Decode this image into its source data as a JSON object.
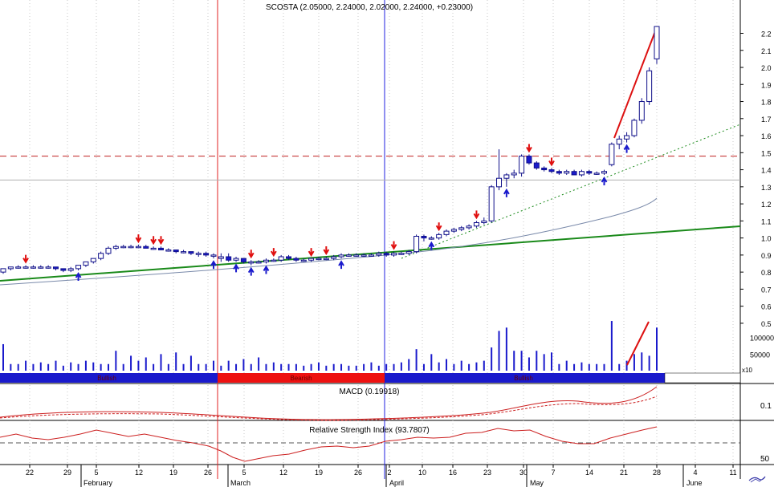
{
  "chart_data": {
    "type": "candlestick",
    "title": "SCOSTA (2.05000, 2.24000, 2.02000, 2.24000, +0.23000)",
    "y_ticks": [
      "2.2",
      "2.1",
      "2.0",
      "1.9",
      "1.8",
      "1.7",
      "1.6",
      "1.5",
      "1.4",
      "1.3",
      "1.2",
      "1.1",
      "1.0",
      "0.9",
      "0.8",
      "0.7",
      "0.6",
      "0.5"
    ],
    "ylim": [
      0.5,
      2.3
    ],
    "volume_ticks": [
      "100000",
      "50000"
    ],
    "volume_unit": "x10",
    "date_ticks": [
      "22",
      "29",
      "5",
      "12",
      "19",
      "26",
      "5",
      "12",
      "19",
      "26",
      "2",
      "10",
      "16",
      "23",
      "30",
      "7",
      "14",
      "21",
      "28",
      "4",
      "11"
    ],
    "months": [
      "February",
      "March",
      "April",
      "May",
      "June"
    ],
    "trend_bands": [
      {
        "label": "Bullish",
        "color": "#1a1acc"
      },
      {
        "label": "Bearish",
        "color": "#ee1111"
      },
      {
        "label": "Bullish",
        "color": "#1a1acc"
      }
    ],
    "resistance_level": 1.48,
    "support_level": 1.34,
    "candles": [
      [
        0.8,
        0.82,
        0.79,
        0.82
      ],
      [
        0.82,
        0.83,
        0.81,
        0.83
      ],
      [
        0.83,
        0.84,
        0.82,
        0.83
      ],
      [
        0.83,
        0.84,
        0.82,
        0.83
      ],
      [
        0.83,
        0.84,
        0.82,
        0.83
      ],
      [
        0.83,
        0.84,
        0.82,
        0.83
      ],
      [
        0.83,
        0.84,
        0.82,
        0.83
      ],
      [
        0.83,
        0.83,
        0.81,
        0.82
      ],
      [
        0.82,
        0.82,
        0.8,
        0.81
      ],
      [
        0.81,
        0.83,
        0.8,
        0.82
      ],
      [
        0.82,
        0.84,
        0.81,
        0.84
      ],
      [
        0.84,
        0.86,
        0.83,
        0.86
      ],
      [
        0.86,
        0.88,
        0.85,
        0.88
      ],
      [
        0.88,
        0.92,
        0.87,
        0.91
      ],
      [
        0.91,
        0.95,
        0.9,
        0.94
      ],
      [
        0.94,
        0.96,
        0.93,
        0.95
      ],
      [
        0.95,
        0.96,
        0.94,
        0.95
      ],
      [
        0.95,
        0.96,
        0.94,
        0.95
      ],
      [
        0.95,
        0.96,
        0.94,
        0.95
      ],
      [
        0.95,
        0.96,
        0.94,
        0.94
      ],
      [
        0.94,
        0.95,
        0.93,
        0.94
      ],
      [
        0.94,
        0.95,
        0.93,
        0.93
      ],
      [
        0.93,
        0.94,
        0.92,
        0.93
      ],
      [
        0.93,
        0.93,
        0.91,
        0.92
      ],
      [
        0.92,
        0.93,
        0.91,
        0.92
      ],
      [
        0.92,
        0.92,
        0.9,
        0.91
      ],
      [
        0.91,
        0.92,
        0.89,
        0.91
      ],
      [
        0.91,
        0.92,
        0.89,
        0.9
      ],
      [
        0.9,
        0.91,
        0.88,
        0.9
      ],
      [
        0.88,
        0.91,
        0.86,
        0.89
      ],
      [
        0.89,
        0.91,
        0.86,
        0.87
      ],
      [
        0.87,
        0.89,
        0.86,
        0.88
      ],
      [
        0.88,
        0.88,
        0.85,
        0.86
      ],
      [
        0.86,
        0.87,
        0.84,
        0.86
      ],
      [
        0.86,
        0.87,
        0.85,
        0.86
      ],
      [
        0.86,
        0.88,
        0.85,
        0.87
      ],
      [
        0.87,
        0.88,
        0.86,
        0.87
      ],
      [
        0.87,
        0.9,
        0.86,
        0.89
      ],
      [
        0.89,
        0.9,
        0.87,
        0.88
      ],
      [
        0.88,
        0.89,
        0.86,
        0.87
      ],
      [
        0.87,
        0.88,
        0.86,
        0.87
      ],
      [
        0.87,
        0.88,
        0.86,
        0.88
      ],
      [
        0.88,
        0.89,
        0.87,
        0.88
      ],
      [
        0.88,
        0.89,
        0.87,
        0.88
      ],
      [
        0.88,
        0.9,
        0.87,
        0.89
      ],
      [
        0.89,
        0.91,
        0.88,
        0.9
      ],
      [
        0.9,
        0.91,
        0.89,
        0.9
      ],
      [
        0.9,
        0.91,
        0.89,
        0.9
      ],
      [
        0.9,
        0.91,
        0.89,
        0.9
      ],
      [
        0.9,
        0.91,
        0.89,
        0.9
      ],
      [
        0.9,
        0.92,
        0.89,
        0.91
      ],
      [
        0.91,
        0.92,
        0.89,
        0.9
      ],
      [
        0.9,
        0.92,
        0.89,
        0.91
      ],
      [
        0.91,
        0.92,
        0.9,
        0.91
      ],
      [
        0.91,
        0.93,
        0.9,
        0.92
      ],
      [
        0.92,
        1.02,
        0.91,
        1.01
      ],
      [
        1.01,
        1.02,
        0.98,
        1.0
      ],
      [
        1.0,
        1.01,
        0.99,
        1.0
      ],
      [
        1.0,
        1.03,
        0.99,
        1.02
      ],
      [
        1.02,
        1.05,
        1.01,
        1.04
      ],
      [
        1.04,
        1.06,
        1.03,
        1.05
      ],
      [
        1.05,
        1.07,
        1.04,
        1.06
      ],
      [
        1.06,
        1.08,
        1.05,
        1.07
      ],
      [
        1.07,
        1.1,
        1.06,
        1.09
      ],
      [
        1.09,
        1.12,
        1.08,
        1.1
      ],
      [
        1.1,
        1.31,
        1.09,
        1.3
      ],
      [
        1.3,
        1.52,
        1.28,
        1.35
      ],
      [
        1.35,
        1.38,
        1.3,
        1.37
      ],
      [
        1.37,
        1.4,
        1.35,
        1.38
      ],
      [
        1.38,
        1.49,
        1.36,
        1.48
      ],
      [
        1.48,
        1.49,
        1.43,
        1.44
      ],
      [
        1.44,
        1.45,
        1.4,
        1.41
      ],
      [
        1.41,
        1.42,
        1.39,
        1.4
      ],
      [
        1.4,
        1.41,
        1.38,
        1.39
      ],
      [
        1.39,
        1.4,
        1.37,
        1.38
      ],
      [
        1.38,
        1.4,
        1.37,
        1.39
      ],
      [
        1.39,
        1.4,
        1.37,
        1.37
      ],
      [
        1.37,
        1.4,
        1.36,
        1.39
      ],
      [
        1.39,
        1.4,
        1.37,
        1.38
      ],
      [
        1.38,
        1.39,
        1.37,
        1.38
      ],
      [
        1.38,
        1.4,
        1.37,
        1.39
      ],
      [
        1.43,
        1.56,
        1.42,
        1.55
      ],
      [
        1.55,
        1.6,
        1.52,
        1.58
      ],
      [
        1.58,
        1.62,
        1.56,
        1.6
      ],
      [
        1.6,
        1.7,
        1.59,
        1.69
      ],
      [
        1.69,
        1.82,
        1.67,
        1.8
      ],
      [
        1.8,
        2.0,
        1.78,
        1.98
      ],
      [
        2.05,
        2.24,
        2.02,
        2.24
      ]
    ],
    "volume": [
      80000,
      20000,
      20000,
      30000,
      20000,
      25000,
      20000,
      30000,
      15000,
      25000,
      20000,
      30000,
      25000,
      20000,
      20000,
      60000,
      20000,
      45000,
      30000,
      40000,
      20000,
      50000,
      20000,
      55000,
      20000,
      45000,
      20000,
      20000,
      30000,
      15000,
      30000,
      20000,
      35000,
      20000,
      40000,
      20000,
      25000,
      20000,
      20000,
      20000,
      15000,
      20000,
      25000,
      15000,
      20000,
      20000,
      15000,
      15000,
      20000,
      25000,
      15000,
      20000,
      20000,
      25000,
      35000,
      65000,
      20000,
      50000,
      25000,
      35000,
      20000,
      30000,
      20000,
      25000,
      30000,
      70000,
      120000,
      130000,
      60000,
      60000,
      40000,
      60000,
      50000,
      55000,
      20000,
      30000,
      20000,
      25000,
      20000,
      20000,
      20000,
      150000,
      20000,
      30000,
      50000,
      55000,
      45000,
      130000
    ],
    "macd_label": "MACD (0.19918)",
    "macd_ticks": [
      "0.1"
    ],
    "rsi_label": "Relative Strength Index (93.7807)",
    "rsi_ticks": [
      "50"
    ]
  }
}
